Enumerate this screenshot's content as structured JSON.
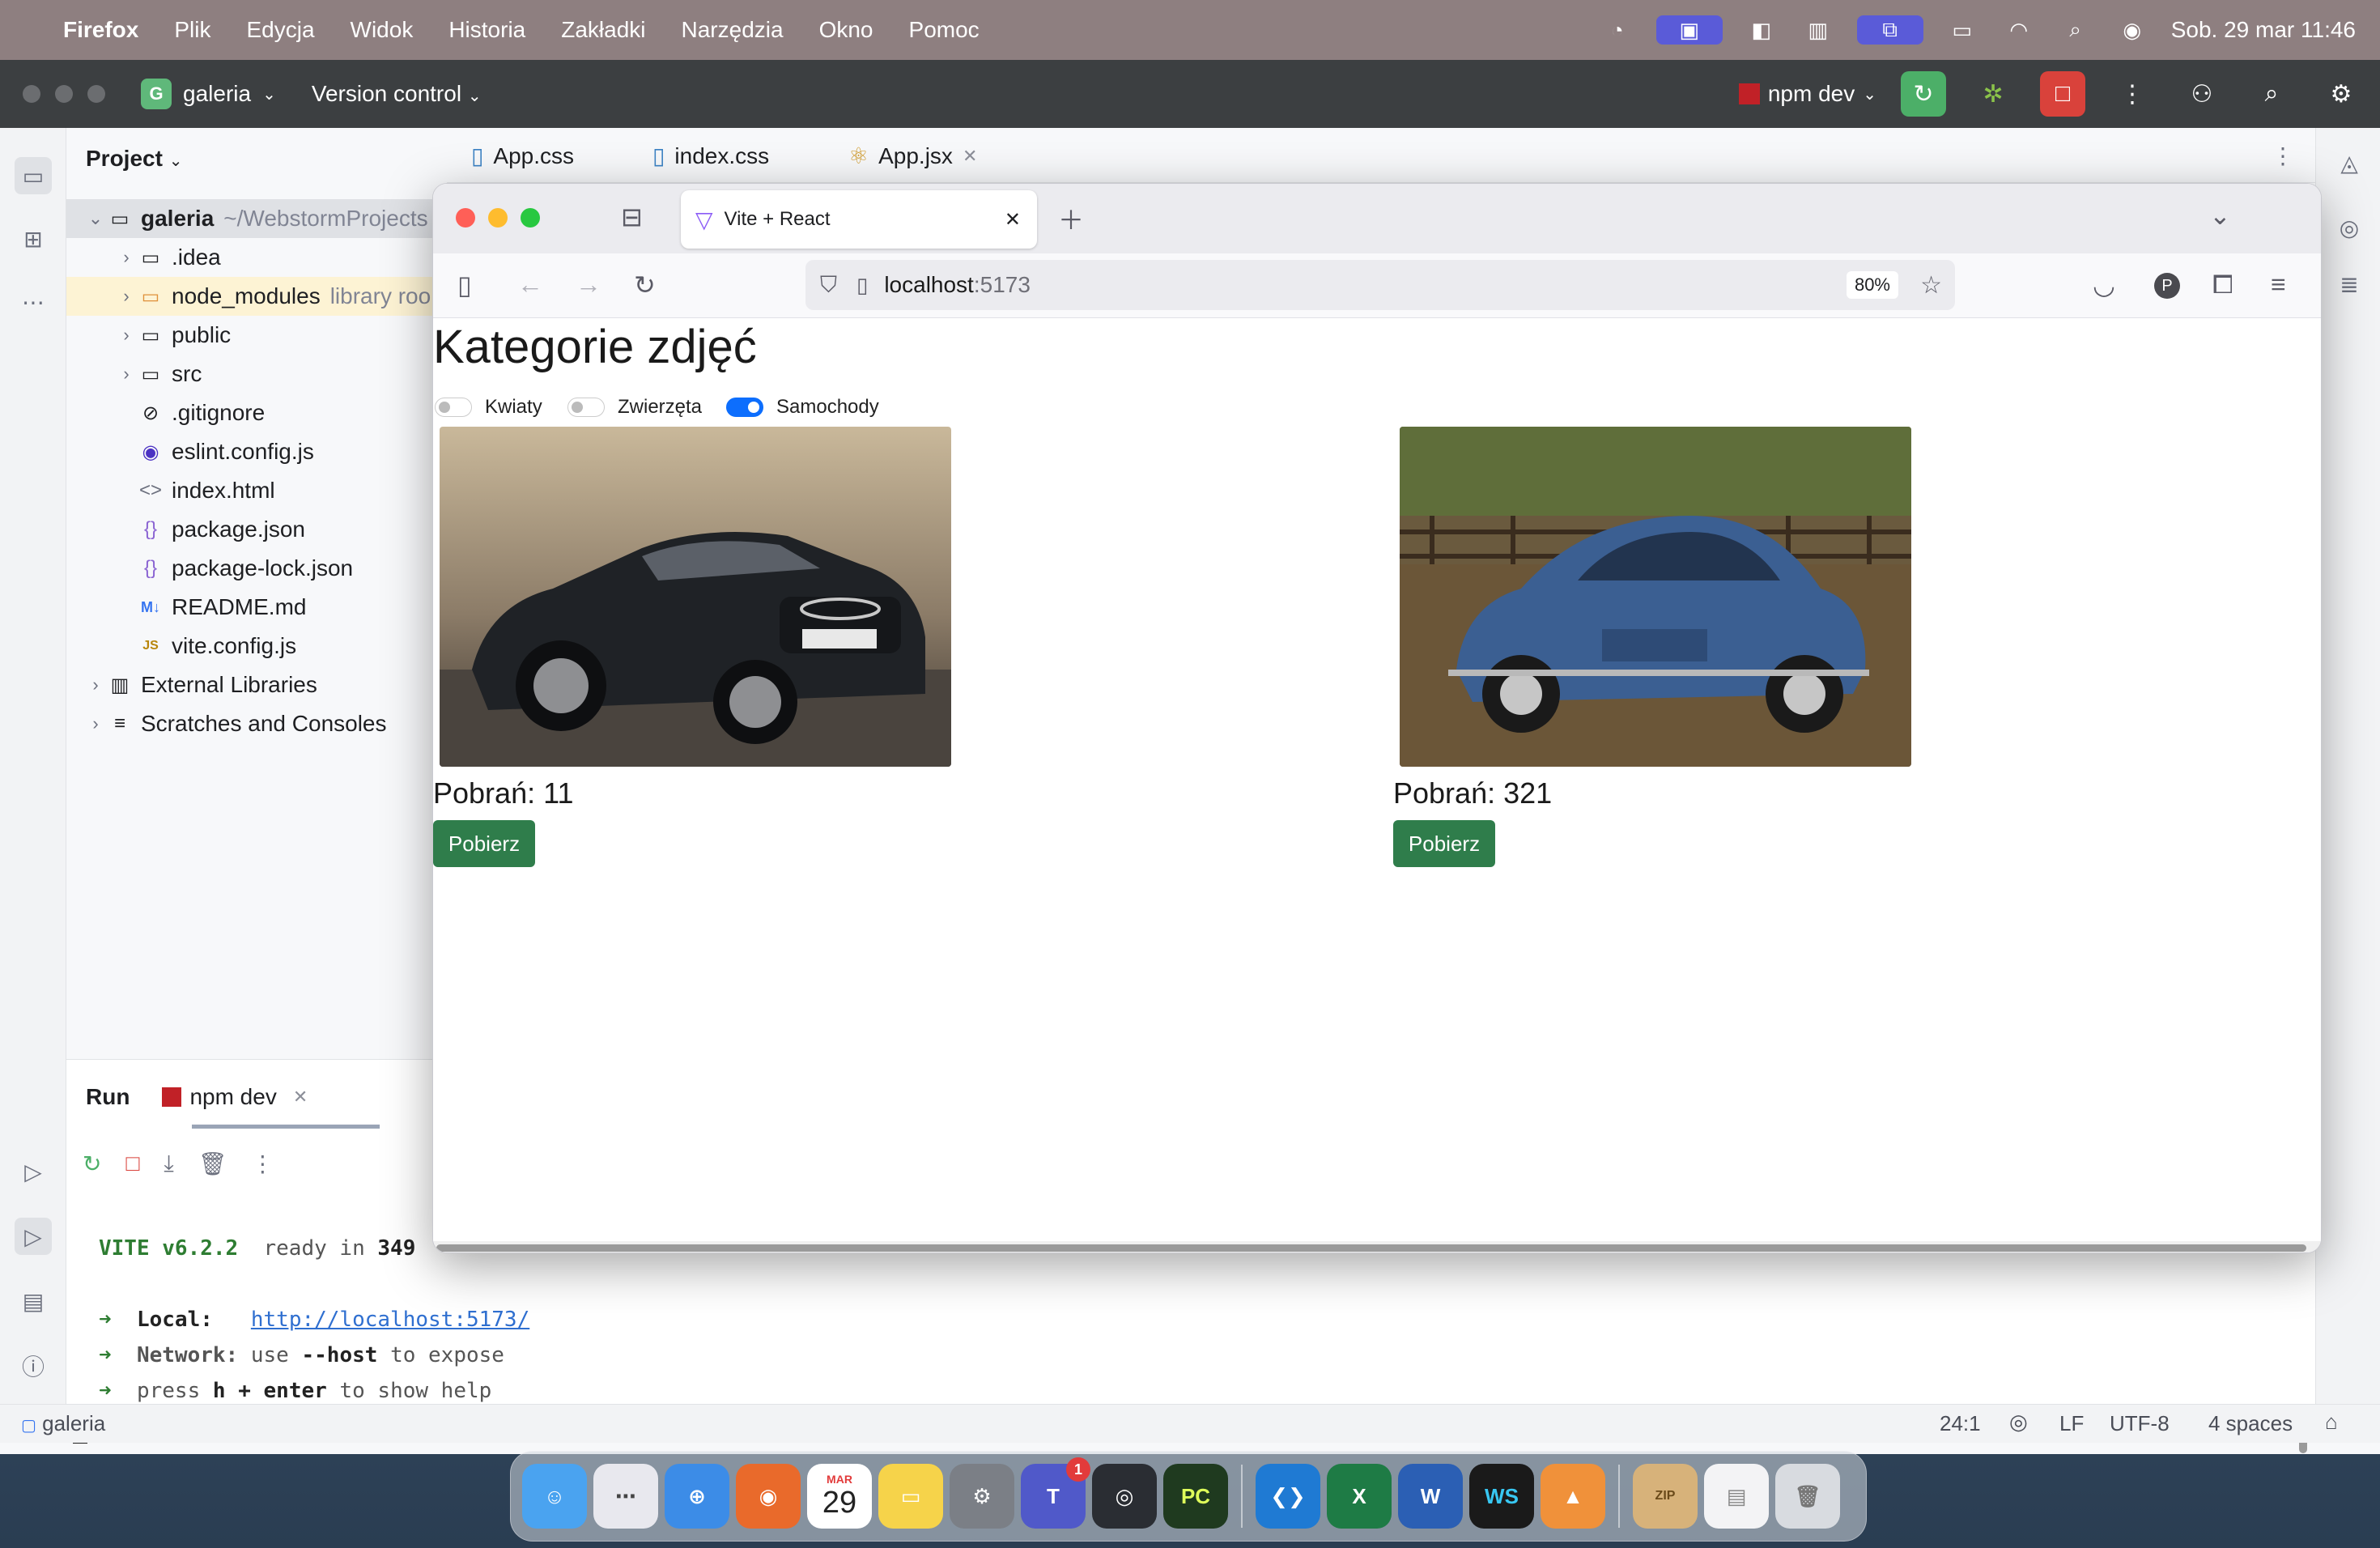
{
  "menubar": {
    "app_name": "Firefox",
    "items": [
      "Plik",
      "Edycja",
      "Widok",
      "Historia",
      "Zakładki",
      "Narzędzia",
      "Okno",
      "Pomoc"
    ],
    "datetime": "Sob. 29 mar  11:46"
  },
  "ide": {
    "project_badge": "G",
    "project_name": "galeria",
    "version_control": "Version control",
    "run_config": "npm dev",
    "panel_title": "Project",
    "tree": [
      {
        "label": "galeria",
        "note": "~/WebstormProjects"
      },
      {
        "label": ".idea"
      },
      {
        "label": "node_modules",
        "note": "library roo"
      },
      {
        "label": "public"
      },
      {
        "label": "src"
      },
      {
        "label": ".gitignore"
      },
      {
        "label": "eslint.config.js"
      },
      {
        "label": "index.html"
      },
      {
        "label": "package.json"
      },
      {
        "label": "package-lock.json"
      },
      {
        "label": "README.md"
      },
      {
        "label": "vite.config.js"
      },
      {
        "label": "External Libraries"
      },
      {
        "label": "Scratches and Consoles"
      }
    ],
    "tabs": [
      "App.css",
      "index.css",
      "App.jsx"
    ],
    "run": {
      "title": "Run",
      "tab": "npm dev",
      "console": {
        "vite": "VITE v6.2.2",
        "ready": "ready in",
        "ms": "349",
        "local_label": "Local:",
        "local_url": "http://localhost:5173/",
        "network_label": "Network:",
        "network_use": "use",
        "network_flag": "--host",
        "network_rest": "to expose",
        "press": "press",
        "press_keys": "h + enter",
        "press_rest": "to show help"
      }
    },
    "status": {
      "project": "galeria",
      "position": "24:1",
      "line_ending": "LF",
      "encoding": "UTF-8",
      "indent": "4 spaces"
    }
  },
  "firefox": {
    "tab_title": "Vite + React",
    "url_host": "localhost",
    "url_port": ":5173",
    "zoom": "80%"
  },
  "page": {
    "title": "Kategorie zdjęć",
    "toggles": [
      {
        "label": "Kwiaty",
        "on": false
      },
      {
        "label": "Zwierzęta",
        "on": false
      },
      {
        "label": "Samochody",
        "on": true
      }
    ],
    "cards": [
      {
        "count": "Pobrań: 11",
        "button": "Pobierz"
      },
      {
        "count": "Pobrań: 321",
        "button": "Pobierz"
      }
    ]
  },
  "dock": {
    "calendar_month": "MAR",
    "calendar_day": "29",
    "teams_badge": "1"
  },
  "colors": {
    "accent_green": "#2f7d4b",
    "toggle_on": "#0d6efd",
    "menubar": "#8e7f80"
  }
}
